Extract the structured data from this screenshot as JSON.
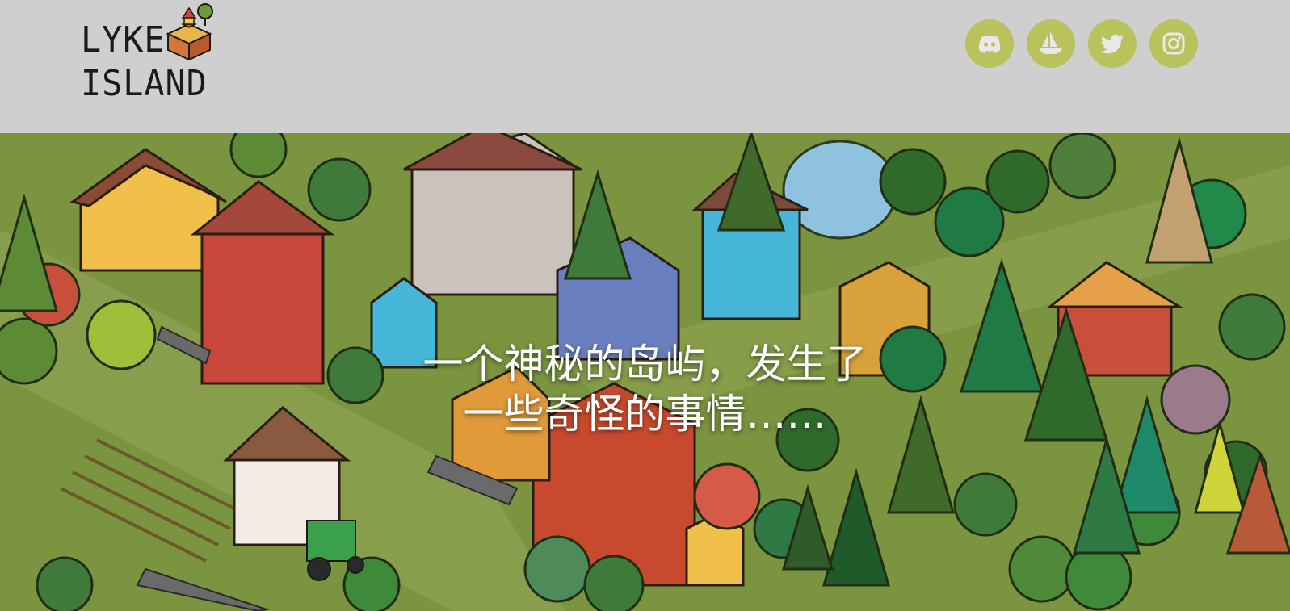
{
  "header": {
    "logo": {
      "line1": "LYKE",
      "line2": "ISLAND"
    },
    "social_links": [
      {
        "name": "discord",
        "icon": "discord-icon"
      },
      {
        "name": "opensea",
        "icon": "opensea-boat-icon"
      },
      {
        "name": "twitter",
        "icon": "twitter-bird-icon"
      },
      {
        "name": "instagram",
        "icon": "instagram-camera-icon"
      }
    ],
    "social_color": "#b9c25d",
    "background": "#cfcfcf"
  },
  "hero": {
    "title_line1": "一个神秘的岛屿，发生了",
    "title_line2": "一些奇怪的事情……",
    "illustration": "isometric-village-map"
  }
}
